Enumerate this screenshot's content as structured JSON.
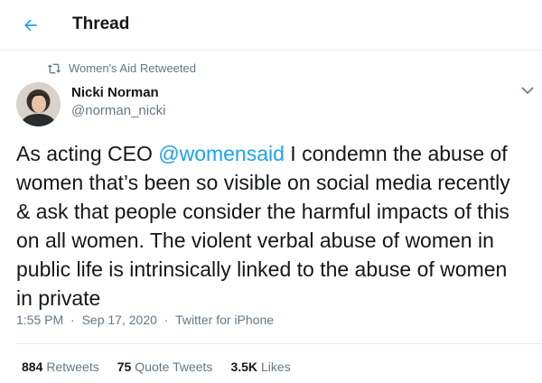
{
  "header": {
    "title": "Thread"
  },
  "retweet": {
    "label": "Women's Aid Retweeted"
  },
  "author": {
    "name": "Nicki Norman",
    "handle": "@norman_nicki"
  },
  "tweet": {
    "prefix": "As acting CEO ",
    "mention": "@womensaid",
    "body": " I condemn the abuse of women that’s been so visible on social media recently & ask that people consider the harmful impacts of this on all women. The violent verbal abuse of women in public life is intrinsically linked to the abuse of women in private"
  },
  "meta": {
    "time": "1:55 PM",
    "date": "Sep 17, 2020",
    "source": "Twitter for iPhone",
    "separator": "·"
  },
  "stats": {
    "retweets": {
      "count": "884",
      "label": "Retweets"
    },
    "quotes": {
      "count": "75",
      "label": "Quote Tweets"
    },
    "likes": {
      "count": "3.5K",
      "label": "Likes"
    }
  },
  "colors": {
    "accent": "#1da1f2",
    "muted": "#657786",
    "text": "#14171a",
    "divider": "#e6ecf0"
  },
  "icons": {
    "back": "back-arrow-icon",
    "retweet": "retweet-icon",
    "caret": "chevron-down-icon"
  }
}
